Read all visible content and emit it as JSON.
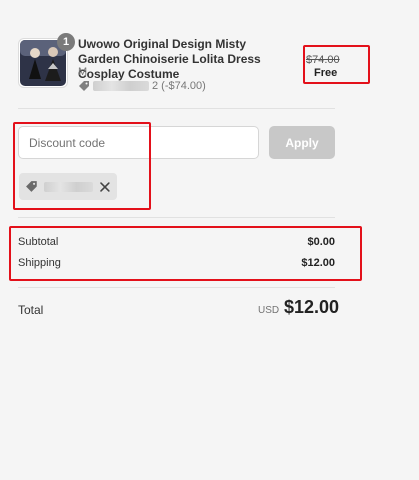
{
  "product": {
    "quantity": "1",
    "title": "Uwowo Original Design Misty Garden Chinoiserie Lolita Dress Cosplay Costume",
    "variant": "M",
    "discount_text": "2 (-$74.00)",
    "price_original": "$74.00",
    "price_final": "Free",
    "icon": "tag-icon"
  },
  "discount": {
    "placeholder": "Discount code",
    "apply_label": "Apply",
    "chip_remove_icon": "close-icon"
  },
  "summary": {
    "subtotal_label": "Subtotal",
    "subtotal_value": "$0.00",
    "shipping_label": "Shipping",
    "shipping_value": "$12.00"
  },
  "total": {
    "label": "Total",
    "currency": "USD",
    "value": "$12.00"
  },
  "colors": {
    "background": "#f5f5f5",
    "annotation": "#e3101a",
    "button_disabled": "#c8c8c8"
  }
}
